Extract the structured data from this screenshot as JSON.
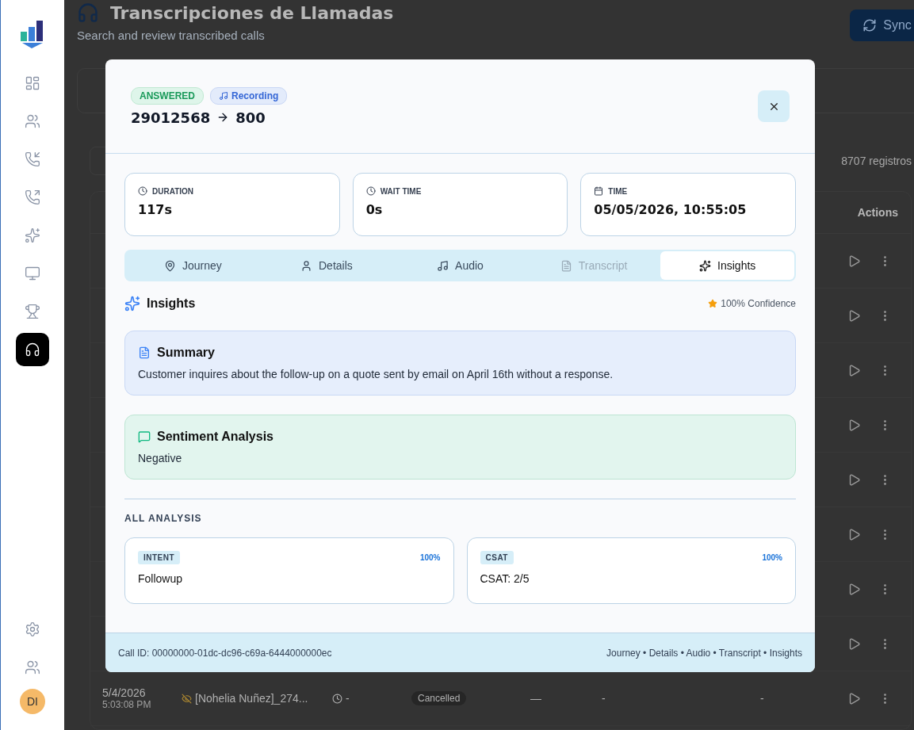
{
  "sidebar": {
    "nav": [
      {
        "selected": false
      },
      {
        "selected": false
      },
      {
        "selected": false
      },
      {
        "selected": false
      },
      {
        "selected": false
      },
      {
        "selected": false
      },
      {
        "selected": false
      },
      {
        "selected": true
      }
    ],
    "avatar": "DI"
  },
  "page": {
    "title": "Transcripciones de Llamadas",
    "subtitle": "Search and review transcribed calls",
    "sync_button": "Sync",
    "record_count": "8707 registros",
    "table": {
      "columns": [
        "Actions"
      ],
      "rows": [
        {
          "date": "5/4/2026",
          "time": "5:03:08 PM",
          "agent": "[Nohelia Nuñez]_274...",
          "wait": "-",
          "status": "Cancelled",
          "column_6": "—",
          "column_7": "-",
          "column_8": "-"
        }
      ]
    }
  },
  "modal": {
    "status_badge": "ANSWERED",
    "recording_badge": "Recording",
    "from": "29012568",
    "to": "800",
    "stats": [
      {
        "label": "DURATION",
        "value": "117s"
      },
      {
        "label": "WAIT TIME",
        "value": "0s"
      },
      {
        "label": "TIME",
        "value": "05/05/2026, 10:55:05"
      }
    ],
    "tabs": [
      {
        "label": "Journey",
        "selected": false,
        "disabled": false
      },
      {
        "label": "Details",
        "selected": false,
        "disabled": false
      },
      {
        "label": "Audio",
        "selected": false,
        "disabled": false
      },
      {
        "label": "Transcript",
        "selected": false,
        "disabled": true
      },
      {
        "label": "Insights",
        "selected": true,
        "disabled": false
      }
    ],
    "section_title": "Insights",
    "confidence": "100% Confidence",
    "cards": [
      {
        "kind": "summary",
        "title": "Summary",
        "text": "Customer inquires about the follow-up on a quote sent by email on April 16th without a response."
      },
      {
        "kind": "sentiment",
        "title": "Sentiment Analysis",
        "text": "Negative"
      }
    ],
    "analysis_heading": "ALL ANALYSIS",
    "analysis": [
      {
        "tag": "INTENT",
        "score": "100%",
        "value": "Followup"
      },
      {
        "tag": "CSAT",
        "score": "100%",
        "value": "CSAT: 2/5"
      }
    ],
    "footer": {
      "call_id": "Call ID: 00000000-01dc-dc96-c69a-6444000000ec",
      "links": "Journey • Details • Audio • Transcript • Insights"
    }
  }
}
